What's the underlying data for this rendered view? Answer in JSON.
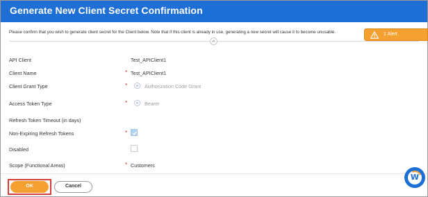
{
  "dialog": {
    "title": "Generate New Client Secret Confirmation",
    "message": "Please confirm that you wish to generate client secret for the Client below. Note that if this client is already in use, generating a new secret will cause it to become unusable.",
    "alert_label": "1 Alert",
    "accent_color": "#1d6fd6",
    "alert_color": "#f5a031"
  },
  "fields": {
    "api_client": {
      "label": "API Client",
      "value": "Test_APIClient1"
    },
    "client_name": {
      "label": "Client Name",
      "required": "*",
      "value": "Test_APIClient1"
    },
    "client_grant_type": {
      "label": "Client Grant Type",
      "required": "*",
      "value": "Authorization Code Grant"
    },
    "access_token_type": {
      "label": "Access Token Type",
      "required": "*",
      "value": "Bearer"
    },
    "refresh_token_timeout": {
      "label": "Refresh Token Timeout (in days)"
    },
    "non_expiring_refresh_tokens": {
      "label": "Non-Expiring Refresh Tokens",
      "required": "*",
      "checked": true
    },
    "disabled": {
      "label": "Disabled",
      "checked": false
    },
    "scope": {
      "label": "Scope (Functional Areas)",
      "required": "*",
      "value": "Customers"
    }
  },
  "footer": {
    "ok_label": "OK",
    "cancel_label": "Cancel",
    "assistant_icon": "W"
  }
}
